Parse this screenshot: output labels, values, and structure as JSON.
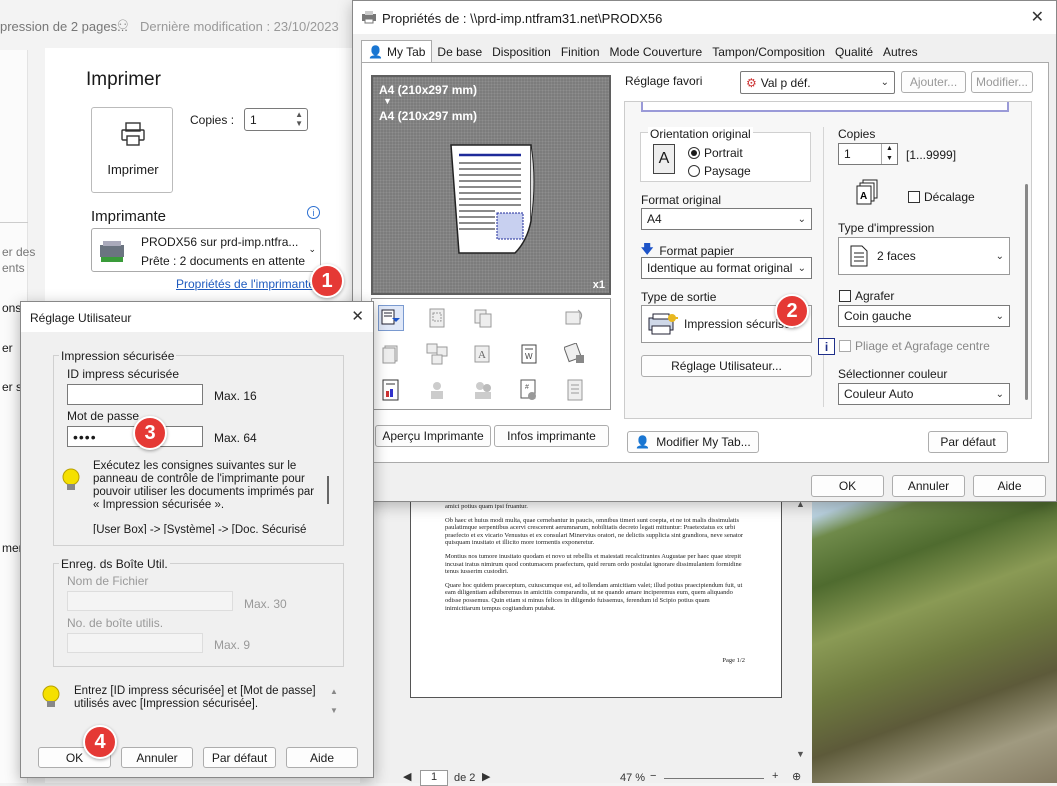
{
  "doc_header": {
    "title": "pression de 2 pages...",
    "modified": "Dernière modification : 23/10/2023"
  },
  "print_panel": {
    "heading": "Imprimer",
    "print_button": "Imprimer",
    "copies_label": "Copies :",
    "copies_value": "1",
    "printer_heading": "Imprimante",
    "printer_name": "PRODX56 sur prd-imp.ntfra...",
    "printer_status": "Prête : 2 documents en attente",
    "printer_props_link": "Propriétés de l'imprimante"
  },
  "left_fragments": [
    "er des",
    "ents",
    "ons",
    "er",
    "er so",
    "mer"
  ],
  "props_window": {
    "title": "Propriétés de : \\\\prd-imp.ntfram31.net\\PRODX56",
    "tabs": [
      "My Tab",
      "De base",
      "Disposition",
      "Finition",
      "Mode Couverture",
      "Tampon/Composition",
      "Qualité",
      "Autres"
    ],
    "preview_size_a": "A4 (210x297 mm)",
    "preview_arrow": "▼",
    "preview_size_b": "A4 (210x297 mm)",
    "preview_count": "x1",
    "preview_btn": "Aperçu Imprimante",
    "info_btn": "Infos imprimante",
    "favorite_label": "Réglage favori",
    "favorite_value": "Val p déf.",
    "add_btn": "Ajouter...",
    "modify_btn": "Modifier...",
    "orientation_label": "Orientation original",
    "portrait": "Portrait",
    "landscape": "Paysage",
    "format_orig_label": "Format original",
    "format_orig_value": "A4",
    "paper_format_label": "Format papier",
    "paper_format_value": "Identique au format original",
    "output_type_label": "Type de sortie",
    "output_type_value": "Impression sécurisée",
    "user_settings_btn": "Réglage Utilisateur...",
    "copies_label": "Copies",
    "copies_value": "1",
    "copies_range": "[1...9999]",
    "offset_label": "Décalage",
    "print_type_label": "Type d'impression",
    "print_type_value": "2 faces",
    "staple_label": "Agrafer",
    "staple_value": "Coin gauche",
    "fold_label": "Pliage et Agrafage centre",
    "color_label": "Sélectionner couleur",
    "color_value": "Couleur Auto",
    "modify_mytab_btn": "Modifier My Tab...",
    "default_btn": "Par défaut",
    "ok_btn": "OK",
    "cancel_btn": "Annuler",
    "help_btn": "Aide"
  },
  "user_dialog": {
    "title": "Réglage Utilisateur",
    "secure_group": "Impression sécurisée",
    "id_label": "ID impress sécurisée",
    "id_value": "",
    "id_max": "Max. 16",
    "password_label": "Mot de passe",
    "password_value": "••••",
    "password_max": "Max. 64",
    "hint_text": "Exécutez les consignes suivantes sur le panneau de contrôle de l'imprimante pour pouvoir utiliser les documents imprimés par « Impression sécurisée ».",
    "hint_text2": "[User Box] -> [Système] -> [Doc. Sécurisé Boîte",
    "box_group": "Enreg. ds Boîte Util.",
    "filename_label": "Nom de Fichier",
    "filename_max": "Max. 30",
    "boxname_label": "No. de boîte utilis.",
    "boxname_max": "Max. 9",
    "info_text": "Entrez [ID impress sécurisée] et [Mot de passe] utilisés avec [Impression sécurisée].",
    "ok_btn": "OK",
    "cancel_btn": "Annuler",
    "default_btn": "Par défaut",
    "help_btn": "Aide"
  },
  "doc_page": {
    "p0": "amici potius quam ipsi fruantur.",
    "p1": "Ob haec et huius modi multa, quae cernebantur in paucis, omnibus timeri sunt coepta, et ne tot malis dissimulatis paulatimque serpentibus acervi crescerent aerumnarum, nobilitatis decreto legati mittuntur: Praetextatus ex urbi praefecto et ex vicario Venustus et ex consulari Minervius oratori, ne delictis supplicia sint grandiora, neve senator quisquam inusitato et illicito more tormentis exponeretur.",
    "p2": "Montius nos tumore inusitato quodam et novo ut rebellis et maiestati recalcitrantes Augustae per haec quae strepit incusat iratus nimirum quod contumacem praefectum, quid rerum ordo postulat ignorare dissimulantem formidine tenus iusserim custodiri.",
    "p3": "Quare hoc quidem praeceptum, cuiuscumque est, ad tollendam amicitiam valet; illud potius praecipiendum fuit, ut eam diligentiam adhiberemus in amicitiis comparandis, ut ne quando amare inciperemus eum, quem aliquando odisse possemus. Quin etiam si minus felices in diligendo fuissemus, ferendum id Scipio potius quam inimicitiarum tempus cogitandum putabat.",
    "page_label": "Page 1/2",
    "page_input": "1",
    "page_total": "de 2",
    "zoom": "47 %"
  },
  "markers": [
    "1",
    "2",
    "3",
    "4"
  ]
}
